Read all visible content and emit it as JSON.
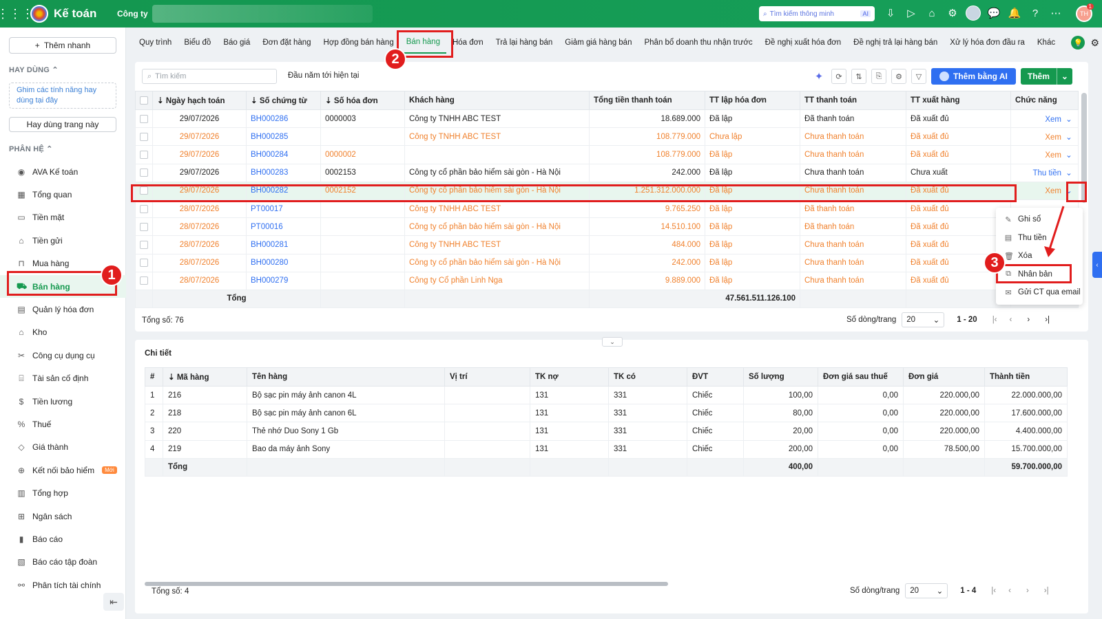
{
  "topbar": {
    "app_title": "Kế toán",
    "company_label": "Công ty",
    "search_placeholder": "Tìm kiếm thông minh",
    "search_ai": "AI",
    "user_initials": "TH",
    "notification_count": "1"
  },
  "sidebar": {
    "add_branch": "Thêm nhanh",
    "section_favorites": "HAY DÙNG",
    "pin_hint": "Ghim các tính năng hay dùng tại đây",
    "favorite_page": "Hay dùng trang này",
    "section_modules": "PHÂN HỆ",
    "items": [
      {
        "label": "AVA Kế toán",
        "icon": "ava-icon"
      },
      {
        "label": "Tổng quan",
        "icon": "dashboard-icon"
      },
      {
        "label": "Tiền mặt",
        "icon": "cash-icon"
      },
      {
        "label": "Tiền gửi",
        "icon": "bank-icon"
      },
      {
        "label": "Mua hàng",
        "icon": "shopping-bag-icon"
      },
      {
        "label": "Bán hàng",
        "icon": "cart-icon"
      },
      {
        "label": "Quản lý hóa đơn",
        "icon": "invoice-icon"
      },
      {
        "label": "Kho",
        "icon": "warehouse-icon"
      },
      {
        "label": "Công cụ dụng cụ",
        "icon": "tools-icon"
      },
      {
        "label": "Tài sản cố định",
        "icon": "asset-icon"
      },
      {
        "label": "Tiền lương",
        "icon": "salary-icon"
      },
      {
        "label": "Thuế",
        "icon": "tax-icon"
      },
      {
        "label": "Giá thành",
        "icon": "price-tag-icon"
      },
      {
        "label": "Kết nối bảo hiểm",
        "icon": "insurance-icon",
        "badge": "Mới"
      },
      {
        "label": "Tổng hợp",
        "icon": "summary-icon"
      },
      {
        "label": "Ngân sách",
        "icon": "budget-icon"
      },
      {
        "label": "Báo cáo",
        "icon": "report-icon"
      },
      {
        "label": "Báo cáo tập đoàn",
        "icon": "group-report-icon"
      },
      {
        "label": "Phân tích tài chính",
        "icon": "analysis-icon"
      }
    ]
  },
  "tabs": [
    "Quy trình",
    "Biểu đồ",
    "Báo giá",
    "Đơn đặt hàng",
    "Hợp đồng bán hàng",
    "Bán hàng",
    "Hóa đơn",
    "Trả lại hàng bán",
    "Giảm giá hàng bán",
    "Phân bổ doanh thu nhận trước",
    "Đề nghị xuất hóa đơn",
    "Đề nghị trả lại hàng bán",
    "Xử lý hóa đơn đầu ra",
    "Khác"
  ],
  "list": {
    "search_placeholder": "Tìm kiếm",
    "period": "Đầu năm tới hiện tại",
    "add_ai": "Thêm bằng AI",
    "add": "Thêm",
    "columns": [
      "Ngày hạch toán",
      "Số chứng từ",
      "Số hóa đơn",
      "Khách hàng",
      "Tổng tiền thanh toán",
      "TT lập hóa đơn",
      "TT thanh toán",
      "TT xuất hàng",
      "Chức năng"
    ],
    "rows": [
      {
        "date": "29/07/2026",
        "doc": "BH000286",
        "invoice": "0000003",
        "customer": "Công ty TNHH ABC TEST",
        "total": "18.689.000",
        "inv_status": "Đã lập",
        "pay_status": "Đã thanh toán",
        "ship_status": "Đã xuất đủ",
        "action": "Xem",
        "style": "normal"
      },
      {
        "date": "29/07/2026",
        "doc": "BH000285",
        "invoice": "",
        "customer": "Công ty TNHH ABC TEST",
        "total": "108.779.000",
        "inv_status": "Chưa lập",
        "pay_status": "Chưa thanh toán",
        "ship_status": "Đã xuất đủ",
        "action": "Xem",
        "style": "orange"
      },
      {
        "date": "29/07/2026",
        "doc": "BH000284",
        "invoice": "0000002",
        "customer": "",
        "total": "108.779.000",
        "inv_status": "Đã lập",
        "pay_status": "Chưa thanh toán",
        "ship_status": "Đã xuất đủ",
        "action": "Xem",
        "style": "orange"
      },
      {
        "date": "29/07/2026",
        "doc": "BH000283",
        "invoice": "0002153",
        "customer": "Công ty cổ phần bảo hiểm sài gòn - Hà Nội",
        "total": "242.000",
        "inv_status": "Đã lập",
        "pay_status": "Chưa thanh toán",
        "ship_status": "Chưa xuất",
        "action": "Thu tiền",
        "style": "normal"
      },
      {
        "date": "29/07/2026",
        "doc": "BH000282",
        "invoice": "0002152",
        "customer": "Công ty cổ phần bảo hiểm sài gòn - Hà Nội",
        "total": "1.251.312.000.000",
        "inv_status": "Đã lập",
        "pay_status": "Chưa thanh toán",
        "ship_status": "Đã xuất đủ",
        "action": "Xem",
        "style": "selected"
      },
      {
        "date": "28/07/2026",
        "doc": "PT00017",
        "invoice": "",
        "customer": "Công ty TNHH ABC TEST",
        "total": "9.765.250",
        "inv_status": "Đã lập",
        "pay_status": "Đã thanh toán",
        "ship_status": "Đã xuất đủ",
        "action": "",
        "style": "orange"
      },
      {
        "date": "28/07/2026",
        "doc": "PT00016",
        "invoice": "",
        "customer": "Công ty cổ phần bảo hiểm sài gòn - Hà Nội",
        "total": "14.510.100",
        "inv_status": "Đã lập",
        "pay_status": "Đã thanh toán",
        "ship_status": "Đã xuất đủ",
        "action": "",
        "style": "orange"
      },
      {
        "date": "28/07/2026",
        "doc": "BH000281",
        "invoice": "",
        "customer": "Công ty TNHH ABC TEST",
        "total": "484.000",
        "inv_status": "Đã lập",
        "pay_status": "Chưa thanh toán",
        "ship_status": "Đã xuất đủ",
        "action": "",
        "style": "orange"
      },
      {
        "date": "28/07/2026",
        "doc": "BH000280",
        "invoice": "",
        "customer": "Công ty cổ phần bảo hiểm sài gòn - Hà Nội",
        "total": "242.000",
        "inv_status": "Đã lập",
        "pay_status": "Chưa thanh toán",
        "ship_status": "Đã xuất đủ",
        "action": "",
        "style": "orange"
      },
      {
        "date": "28/07/2026",
        "doc": "BH000279",
        "invoice": "",
        "customer": "Công ty Cổ phần Linh Nga",
        "total": "9.889.000",
        "inv_status": "Đã lập",
        "pay_status": "Chưa thanh toán",
        "ship_status": "Đã xuất đủ",
        "action": "",
        "style": "orange"
      }
    ],
    "total_label": "Tổng",
    "total_value": "47.561.511.126.100",
    "count_label": "Tổng số: 76",
    "rows_per_page_label": "Số dòng/trang",
    "rows_per_page": "20",
    "range": "1 - 20"
  },
  "dropdown": [
    {
      "label": "Ghi sổ",
      "icon": "pencil-icon"
    },
    {
      "label": "Thu tiền",
      "icon": "receipt-icon"
    },
    {
      "label": "Xóa",
      "icon": "trash-icon"
    },
    {
      "label": "Nhân bản",
      "icon": "duplicate-icon"
    },
    {
      "label": "Gửi CT qua email",
      "icon": "mail-icon"
    }
  ],
  "annotations": {
    "step1": "1",
    "step2": "2",
    "step3": "3"
  },
  "detail": {
    "title": "Chi tiết",
    "columns": [
      "#",
      "Mã hàng",
      "Tên hàng",
      "Vị trí",
      "TK nợ",
      "TK có",
      "ĐVT",
      "Số lượng",
      "Đơn giá sau thuế",
      "Đơn giá",
      "Thành tiền"
    ],
    "rows": [
      {
        "no": "1",
        "code": "216",
        "name": "Bộ sạc pin máy ảnh canon 4L",
        "pos": "",
        "debit": "131",
        "credit": "331",
        "unit": "Chiếc",
        "qty": "100,00",
        "price_tax": "0,00",
        "price": "220.000,00",
        "amount": "22.000.000,00"
      },
      {
        "no": "2",
        "code": "218",
        "name": "Bộ sạc pin máy ảnh canon 6L",
        "pos": "",
        "debit": "131",
        "credit": "331",
        "unit": "Chiếc",
        "qty": "80,00",
        "price_tax": "0,00",
        "price": "220.000,00",
        "amount": "17.600.000,00"
      },
      {
        "no": "3",
        "code": "220",
        "name": "Thẻ nhớ Duo Sony 1 Gb",
        "pos": "",
        "debit": "131",
        "credit": "331",
        "unit": "Chiếc",
        "qty": "20,00",
        "price_tax": "0,00",
        "price": "220.000,00",
        "amount": "4.400.000,00"
      },
      {
        "no": "4",
        "code": "219",
        "name": "Bao da máy ảnh Sony",
        "pos": "",
        "debit": "131",
        "credit": "331",
        "unit": "Chiếc",
        "qty": "200,00",
        "price_tax": "0,00",
        "price": "78.500,00",
        "amount": "15.700.000,00"
      }
    ],
    "total_label": "Tổng",
    "total_qty": "400,00",
    "total_amount": "59.700.000,00",
    "count_label": "Tổng số: 4",
    "rows_per_page_label": "Số dòng/trang",
    "rows_per_page": "20",
    "range": "1 - 4"
  },
  "colors": {
    "brand": "#15994f",
    "link": "#2f6ff1",
    "warning": "#f0812d",
    "highlight": "#e11d1d"
  }
}
